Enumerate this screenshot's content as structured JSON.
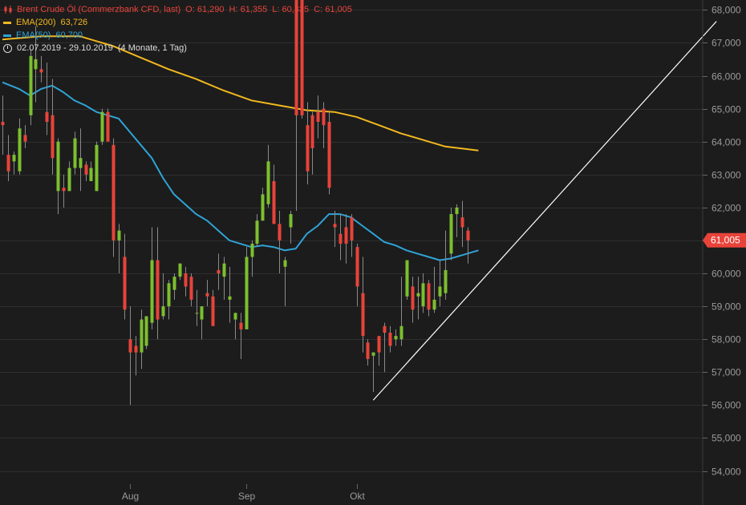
{
  "header": {
    "instrument": "Brent Crude Öl (Commerzbank CFD, last)",
    "open_label": "O:",
    "open": "61,290",
    "high_label": "H:",
    "high": "61,355",
    "low_label": "L:",
    "low": "60,335",
    "close_label": "C:",
    "close": "61,005",
    "ema200_label": "EMA(200)",
    "ema200_value": "63,726",
    "ema50_label": "EMA(50)",
    "ema50_value": "60,700",
    "range": "02.07.2019 - 29.10.2019",
    "period": "(4 Monate, 1 Tag)"
  },
  "colors": {
    "background": "#1c1c1c",
    "grid": "#2e2e2e",
    "up": "#7cbf2f",
    "down": "#e8433a",
    "ema200": "#f2b81f",
    "ema50": "#2fa3d6",
    "price_tag": "#e8433a",
    "axis_text": "#9a9a9a",
    "trendline": "#ffffff"
  },
  "chart_data": {
    "type": "candlestick",
    "y_ticks": [
      "68,000",
      "67,000",
      "66,000",
      "65,000",
      "64,000",
      "63,000",
      "62,000",
      "61,000",
      "60,000",
      "59,000",
      "58,000",
      "57,000",
      "56,000",
      "55,000",
      "54,000"
    ],
    "ylim": [
      53.6,
      68.3
    ],
    "x_labels": [
      {
        "label": "Aug",
        "index": 23
      },
      {
        "label": "Sep",
        "index": 44
      },
      {
        "label": "Okt",
        "index": 64
      }
    ],
    "last_price": 61.005,
    "last_price_label": "61,005",
    "candles": [
      [
        65.4,
        63.6,
        64.6,
        64.5
      ],
      [
        64.2,
        62.8,
        63.6,
        63.1
      ],
      [
        63.7,
        63.0,
        63.4,
        63.6
      ],
      [
        64.7,
        63.0,
        63.1,
        64.4
      ],
      [
        64.5,
        63.8,
        64.2,
        64.0
      ],
      [
        66.8,
        64.5,
        64.8,
        66.6
      ],
      [
        67.5,
        65.2,
        66.2,
        66.5
      ],
      [
        66.6,
        65.8,
        66.2,
        66.1
      ],
      [
        66.4,
        64.2,
        64.9,
        64.6
      ],
      [
        65.9,
        63.0,
        64.8,
        63.5
      ],
      [
        64.1,
        61.8,
        62.5,
        64.0
      ],
      [
        63.0,
        62.0,
        62.6,
        62.5
      ],
      [
        63.4,
        62.5,
        62.5,
        63.2
      ],
      [
        64.3,
        63.0,
        63.2,
        64.1
      ],
      [
        64.4,
        62.5,
        63.2,
        63.5
      ],
      [
        63.4,
        62.8,
        63.3,
        63.0
      ],
      [
        63.4,
        62.8,
        62.8,
        63.2
      ],
      [
        64.0,
        62.5,
        62.5,
        63.9
      ],
      [
        65.0,
        63.9,
        64.0,
        64.9
      ],
      [
        65.0,
        64.0,
        64.9,
        64.0
      ],
      [
        64.1,
        60.5,
        63.9,
        61.0
      ],
      [
        61.5,
        60.0,
        61.0,
        61.3
      ],
      [
        61.2,
        58.6,
        60.5,
        58.9
      ],
      [
        59.0,
        56.0,
        58.0,
        57.6
      ],
      [
        58.1,
        56.9,
        57.8,
        57.6
      ],
      [
        58.9,
        57.1,
        57.6,
        58.6
      ],
      [
        58.6,
        57.7,
        57.8,
        58.7
      ],
      [
        61.4,
        58.3,
        58.5,
        60.4
      ],
      [
        61.4,
        58.0,
        60.4,
        58.6
      ],
      [
        60.0,
        58.6,
        58.7,
        59.0
      ],
      [
        59.8,
        58.6,
        59.0,
        59.7
      ],
      [
        60.0,
        59.2,
        59.5,
        59.9
      ],
      [
        60.3,
        59.8,
        59.9,
        60.3
      ],
      [
        60.2,
        59.3,
        60.0,
        59.6
      ],
      [
        60.0,
        59.0,
        59.9,
        59.2
      ],
      [
        59.5,
        58.4,
        58.8,
        58.8
      ],
      [
        58.8,
        58.0,
        58.6,
        59.0
      ],
      [
        59.8,
        59.0,
        59.4,
        59.3
      ],
      [
        59.5,
        58.4,
        59.3,
        58.4
      ],
      [
        60.6,
        59.5,
        60.1,
        60.0
      ],
      [
        60.5,
        59.2,
        59.9,
        60.3
      ],
      [
        60.2,
        58.5,
        59.2,
        59.3
      ],
      [
        58.8,
        58.0,
        58.6,
        58.8
      ],
      [
        58.8,
        57.4,
        58.5,
        58.3
      ],
      [
        60.8,
        58.3,
        58.3,
        60.5
      ],
      [
        61.0,
        59.9,
        60.5,
        60.9
      ],
      [
        61.8,
        60.8,
        60.9,
        61.6
      ],
      [
        62.6,
        61.6,
        61.6,
        62.4
      ],
      [
        63.9,
        62.0,
        62.1,
        63.4
      ],
      [
        63.3,
        61.6,
        62.8,
        61.5
      ],
      [
        61.9,
        60.0,
        61.5,
        61.0
      ],
      [
        60.5,
        59.0,
        60.2,
        60.4
      ],
      [
        61.9,
        60.9,
        61.4,
        61.8
      ],
      [
        68.7,
        61.9,
        68.5,
        64.8
      ],
      [
        68.5,
        64.7,
        68.3,
        64.8
      ],
      [
        65.2,
        62.7,
        64.5,
        63.1
      ],
      [
        64.9,
        63.0,
        64.8,
        63.8
      ],
      [
        65.4,
        64.1,
        64.9,
        64.6
      ],
      [
        65.2,
        63.8,
        65.0,
        64.5
      ],
      [
        64.9,
        62.4,
        64.6,
        62.6
      ],
      [
        61.9,
        60.8,
        61.5,
        61.4
      ],
      [
        61.8,
        60.4,
        61.2,
        60.9
      ],
      [
        61.8,
        60.3,
        61.4,
        60.9
      ],
      [
        61.8,
        60.5,
        61.7,
        61.0
      ],
      [
        60.9,
        59.0,
        60.8,
        59.6
      ],
      [
        60.5,
        57.6,
        59.4,
        58.1
      ],
      [
        58.0,
        57.2,
        57.9,
        57.4
      ],
      [
        57.6,
        56.4,
        57.5,
        57.6
      ],
      [
        58.0,
        57.2,
        58.1,
        57.6
      ],
      [
        58.5,
        57.0,
        58.4,
        58.2
      ],
      [
        58.4,
        57.6,
        58.2,
        57.8
      ],
      [
        58.3,
        57.8,
        58.0,
        58.1
      ],
      [
        59.9,
        57.8,
        58.0,
        58.4
      ],
      [
        60.3,
        59.2,
        59.3,
        60.4
      ],
      [
        59.9,
        58.5,
        59.6,
        58.9
      ],
      [
        59.9,
        58.6,
        59.3,
        59.4
      ],
      [
        60.0,
        58.8,
        59.0,
        59.7
      ],
      [
        59.8,
        58.7,
        59.7,
        58.9
      ],
      [
        60.2,
        58.8,
        58.9,
        59.2
      ],
      [
        60.4,
        59.0,
        59.3,
        59.6
      ],
      [
        61.3,
        59.2,
        59.4,
        60.1
      ],
      [
        62.0,
        60.4,
        60.6,
        61.8
      ],
      [
        62.1,
        61.1,
        61.8,
        62.0
      ],
      [
        62.2,
        60.8,
        61.7,
        61.4
      ],
      [
        61.4,
        60.3,
        61.3,
        61.0
      ]
    ],
    "ema200": [
      [
        0,
        67.1
      ],
      [
        7,
        67.2
      ],
      [
        14,
        67.2
      ],
      [
        20,
        66.9
      ],
      [
        25,
        66.55
      ],
      [
        30,
        66.2
      ],
      [
        35,
        65.9
      ],
      [
        40,
        65.55
      ],
      [
        45,
        65.25
      ],
      [
        50,
        65.1
      ],
      [
        55,
        64.95
      ],
      [
        60,
        64.9
      ],
      [
        64,
        64.75
      ],
      [
        68,
        64.5
      ],
      [
        72,
        64.25
      ],
      [
        76,
        64.05
      ],
      [
        80,
        63.85
      ],
      [
        86,
        63.73
      ]
    ],
    "ema50": [
      [
        0,
        65.8
      ],
      [
        3,
        65.6
      ],
      [
        5,
        65.4
      ],
      [
        7,
        65.6
      ],
      [
        9,
        65.7
      ],
      [
        11,
        65.5
      ],
      [
        13,
        65.25
      ],
      [
        15,
        65.1
      ],
      [
        17,
        64.9
      ],
      [
        19,
        64.8
      ],
      [
        21,
        64.7
      ],
      [
        23,
        64.3
      ],
      [
        25,
        63.9
      ],
      [
        27,
        63.5
      ],
      [
        29,
        62.9
      ],
      [
        31,
        62.4
      ],
      [
        33,
        62.1
      ],
      [
        35,
        61.8
      ],
      [
        37,
        61.6
      ],
      [
        39,
        61.3
      ],
      [
        41,
        61.0
      ],
      [
        43,
        60.9
      ],
      [
        45,
        60.8
      ],
      [
        47,
        60.85
      ],
      [
        49,
        60.8
      ],
      [
        51,
        60.7
      ],
      [
        53,
        60.75
      ],
      [
        55,
        61.2
      ],
      [
        57,
        61.45
      ],
      [
        59,
        61.8
      ],
      [
        61,
        61.8
      ],
      [
        63,
        61.7
      ],
      [
        65,
        61.45
      ],
      [
        67,
        61.2
      ],
      [
        69,
        60.95
      ],
      [
        71,
        60.85
      ],
      [
        73,
        60.7
      ],
      [
        75,
        60.6
      ],
      [
        77,
        60.5
      ],
      [
        79,
        60.4
      ],
      [
        81,
        60.45
      ],
      [
        83,
        60.55
      ],
      [
        86,
        60.7
      ]
    ],
    "trendline": [
      [
        67,
        56.15
      ],
      [
        129,
        67.65
      ]
    ]
  }
}
